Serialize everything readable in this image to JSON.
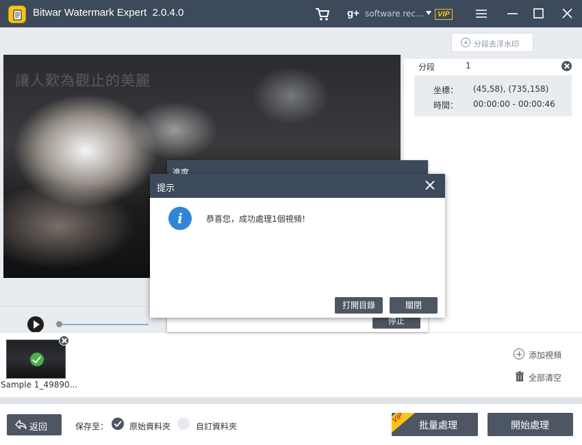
{
  "titlebar": {
    "app_name": "Bitwar Watermark Expert",
    "version": "2.0.4.0",
    "account": "software rec...",
    "vip": "VIP",
    "icons": [
      "app-logo-icon",
      "cart-icon",
      "google-plus-icon",
      "menu-icon",
      "minimize-icon",
      "maximize-icon",
      "close-icon"
    ]
  },
  "video": {
    "watermark_text": "讓人歎為觀止的美麗",
    "progress": 0.27
  },
  "segment_panel": {
    "add_button": "分段去浮水印",
    "segment_label": "分段",
    "segment_index": "1",
    "coord_key": "坐標：",
    "coord_value": "(45,58), (735,158)",
    "time_key": "時間：",
    "time_value": "00:00:00 - 00:00:46"
  },
  "files": {
    "items": [
      {
        "name": "Sample 1_49890...",
        "status": "done"
      }
    ],
    "add_video": "添加視頻",
    "clear_all": "全部清空"
  },
  "bottombar": {
    "back": "返回",
    "save_to": "保存至：",
    "option_original": "原始資料夾",
    "option_custom": "自訂資料夾",
    "selected": "original",
    "batch": "批量處理",
    "batch_badge": "VIP",
    "start": "開始處理"
  },
  "progress_window": {
    "title": "進度",
    "stop": "停止"
  },
  "dialog": {
    "title": "提示",
    "message": "恭喜您，成功處理1個視頻！",
    "open_dir": "打開目錄",
    "close": "關閉"
  },
  "colors": {
    "titlebar": "#3d4a5c",
    "button": "#4d5663",
    "accent_vip": "#f5c518",
    "info": "#2f86d8",
    "success": "#4cae4c"
  }
}
